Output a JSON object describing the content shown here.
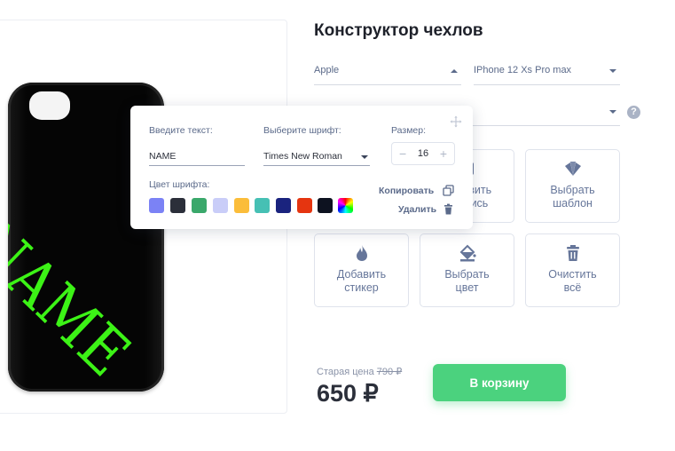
{
  "title": "Конструктор чехлов",
  "selects": {
    "brand": "Apple",
    "model": "IPhone 12 Xs Pro max",
    "third": ""
  },
  "preview": {
    "case_text": "NAME",
    "case_color": "#050505",
    "text_color": "#3cf316"
  },
  "tiles": [
    {
      "label": "Добавить\nнадпись",
      "icon": "text-icon"
    },
    {
      "label": "Выбрать\nшаблон",
      "icon": "template-fan-icon"
    },
    {
      "label": "Добавить\nстикер",
      "icon": "flame-icon"
    },
    {
      "label": "Выбрать\nцвет",
      "icon": "paint-bucket-icon"
    },
    {
      "label": "Очистить\nвсё",
      "icon": "trash-icon"
    }
  ],
  "tile_visible_fragments": {
    "add_text_line1": "вить",
    "add_text_line2": "сь"
  },
  "pricing": {
    "old_price_label": "Старая цена",
    "old_price": "790 ₽",
    "price": "650 ₽",
    "cart_button": "В корзину"
  },
  "editor": {
    "text_label": "Введите текст:",
    "text_value": "NAME",
    "font_label": "Выберите шрифт:",
    "font_value": "Times New Roman",
    "size_label": "Размер:",
    "size_value": "16",
    "size_minus": "−",
    "size_plus": "+",
    "color_label": "Цвет шрифта:",
    "colors": [
      "#7b82f5",
      "#2b2f3a",
      "#3aa86b",
      "#c9cdf8",
      "#fbbd3a",
      "#46c0b4",
      "#1a237e",
      "#e53510",
      "#0d1220",
      "rainbow"
    ],
    "copy_label": "Копировать",
    "delete_label": "Удалить"
  },
  "colors": {
    "accent_green": "#4bd27e",
    "muted_text": "#5b6a8a"
  }
}
